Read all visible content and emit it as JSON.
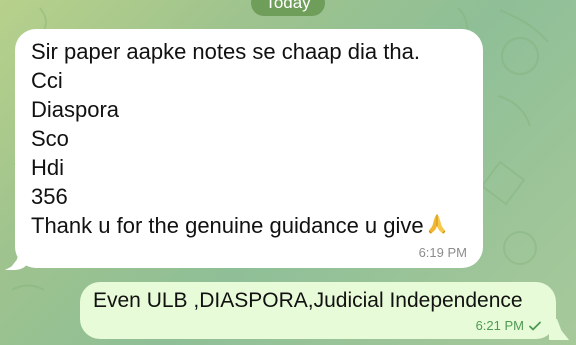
{
  "chat": {
    "date_divider": "Today",
    "incoming": {
      "lines": [
        "Sir paper aapke notes se chaap dia tha.",
        "Cci",
        "Diaspora",
        "Sco",
        "Hdi",
        "356",
        "Thank u for the genuine guidance u give"
      ],
      "emoji": "folded-hands-icon",
      "time": "6:19 PM"
    },
    "outgoing": {
      "text": "Even ULB ,DIASPORA,Judicial Independence",
      "time": "6:21 PM",
      "status_icon": "check-icon"
    }
  },
  "colors": {
    "incoming_bubble": "#ffffff",
    "outgoing_bubble": "#e8fbd8",
    "date_pill": "#6f9e5b",
    "outgoing_time": "#4f9a53",
    "incoming_time": "#8c8c8c"
  }
}
